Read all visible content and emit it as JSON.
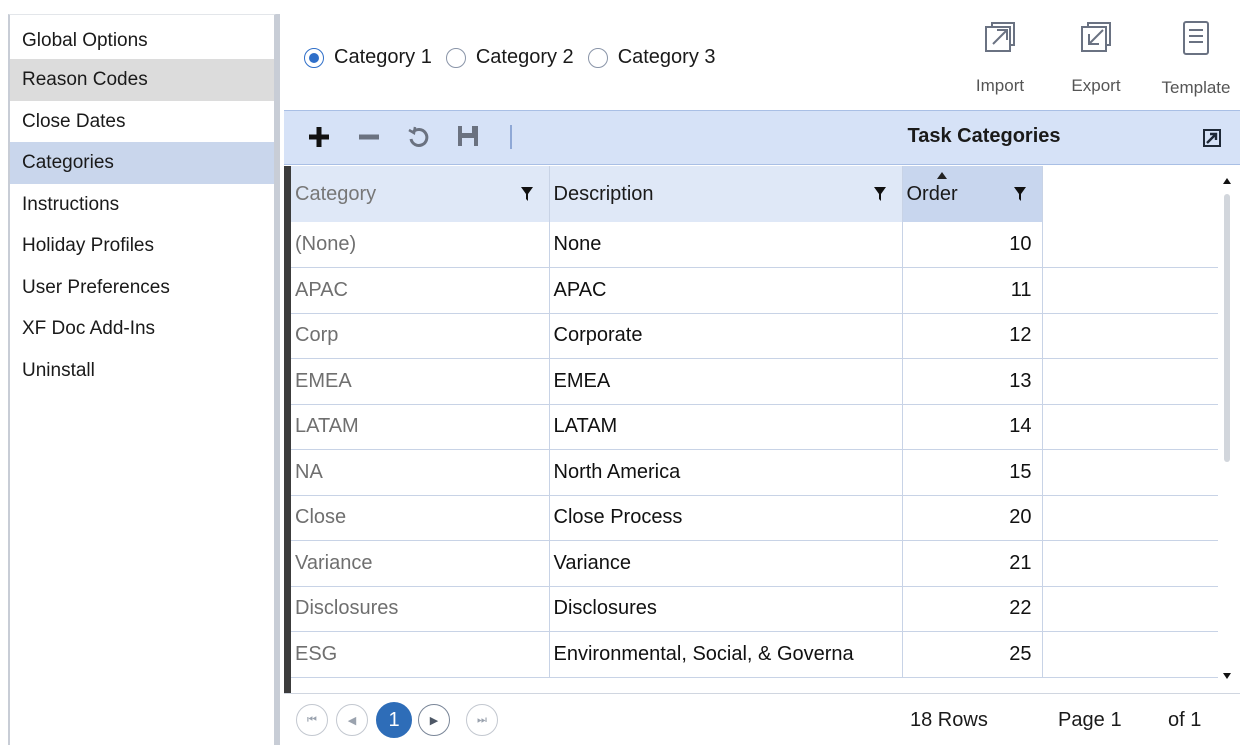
{
  "sidebar": {
    "items": [
      {
        "label": "Global Options"
      },
      {
        "label": "Reason Codes"
      },
      {
        "label": "Close Dates"
      },
      {
        "label": "Categories"
      },
      {
        "label": "Instructions"
      },
      {
        "label": "Holiday Profiles"
      },
      {
        "label": "User Preferences"
      },
      {
        "label": "XF Doc Add-Ins"
      },
      {
        "label": "Uninstall"
      }
    ],
    "active": "Categories",
    "hovered": "Reason Codes"
  },
  "radios": [
    {
      "label": "Category 1",
      "checked": true
    },
    {
      "label": "Category 2",
      "checked": false
    },
    {
      "label": "Category 3",
      "checked": false
    }
  ],
  "actions": {
    "import_label": "Import",
    "export_label": "Export",
    "template_label": "Template"
  },
  "toolbar": {
    "icons": [
      "plus-icon",
      "minus-icon",
      "refresh-icon",
      "save-icon"
    ],
    "title": "Task Categories"
  },
  "grid": {
    "columns": [
      {
        "label": "Category",
        "filter": true
      },
      {
        "label": "Description",
        "filter": true
      },
      {
        "label": "Order",
        "filter": true,
        "sorted": "ascending"
      },
      {
        "label": ""
      }
    ],
    "rows": [
      [
        "(None)",
        "None",
        "10"
      ],
      [
        "APAC",
        "APAC",
        "11"
      ],
      [
        "Corp",
        "Corporate",
        "12"
      ],
      [
        "EMEA",
        "EMEA",
        "13"
      ],
      [
        "LATAM",
        "LATAM",
        "14"
      ],
      [
        "NA",
        "North America",
        "15"
      ],
      [
        "Close",
        "Close Process",
        "20"
      ],
      [
        "Variance",
        "Variance",
        "21"
      ],
      [
        "Disclosures",
        "Disclosures",
        "22"
      ],
      [
        "ESG",
        "Environmental, Social, & Governa",
        "25"
      ]
    ]
  },
  "pager": {
    "current_page": "1",
    "rows_text": "18 Rows",
    "page_label": "Page",
    "page_value": "1",
    "of_text": "of 1"
  },
  "colors": {
    "accent": "#2e6db8",
    "toolbar_bg": "#d6e2f7",
    "active_nav": "#c9d6ec"
  }
}
